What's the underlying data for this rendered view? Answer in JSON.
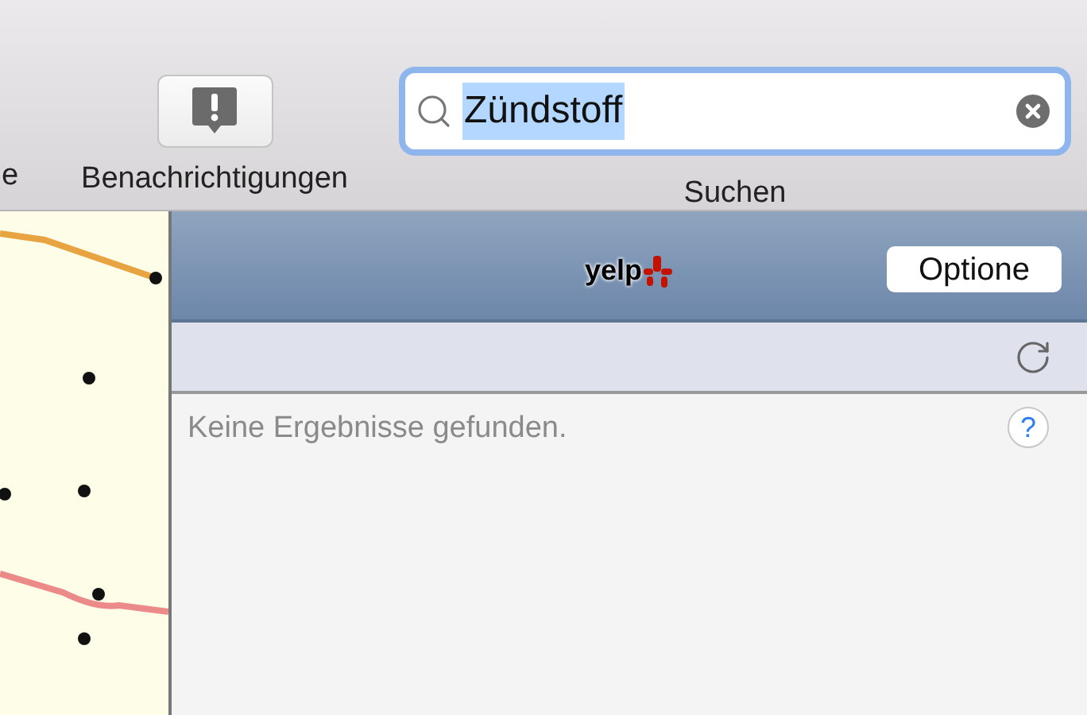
{
  "toolbar": {
    "items": [
      {
        "label": "e"
      },
      {
        "label": "Benachrichtigungen"
      }
    ],
    "search": {
      "value": "Zündstoff",
      "selected": true,
      "label": "Suchen"
    }
  },
  "widget": {
    "logo": "yelp",
    "options_button": "Optione",
    "message": "Keine Ergebnisse gefunden.",
    "help_button": "?"
  }
}
